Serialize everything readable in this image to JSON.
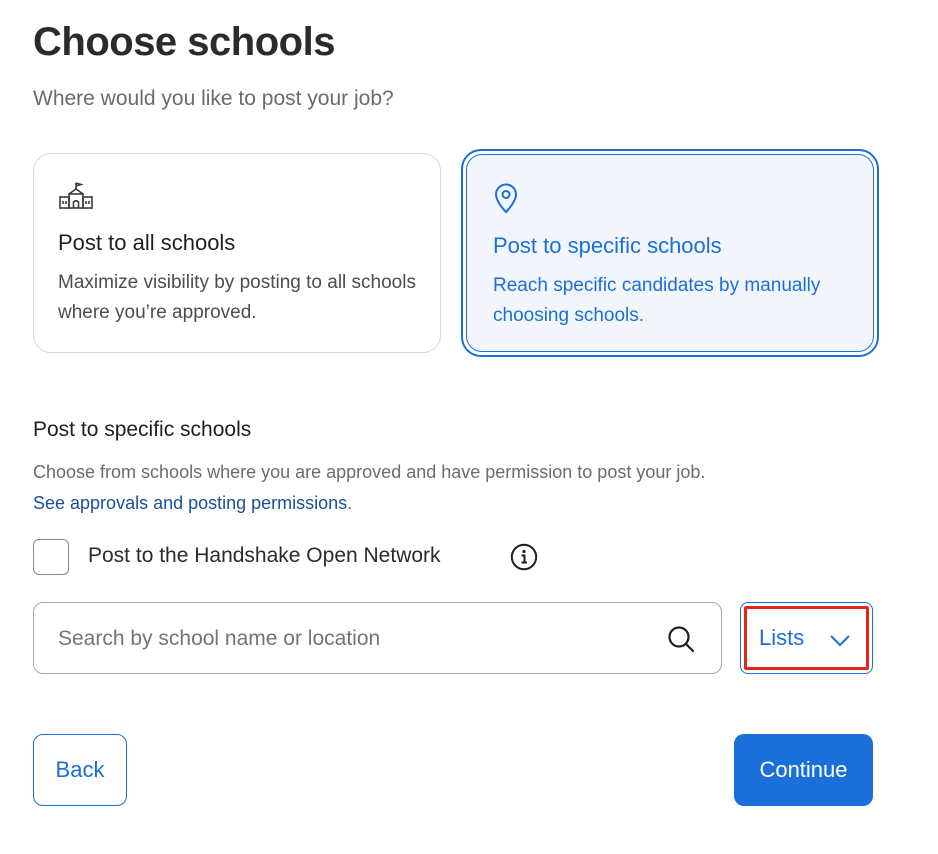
{
  "header": {
    "title": "Choose schools",
    "subtitle": "Where would you like to post your job?"
  },
  "options": [
    {
      "icon": "school-building-icon",
      "heading": "Post to all schools",
      "description": "Maximize visibility by posting to all schools where you’re approved.",
      "selected": false
    },
    {
      "icon": "location-pin-icon",
      "heading": "Post to specific schools",
      "description": "Reach specific candidates by manually choosing schools.",
      "selected": true
    }
  ],
  "specific_section": {
    "title": "Post to specific schools",
    "description": "Choose from schools where you are approved and have permission to post your job.",
    "link_text": "See approvals and posting permissions",
    "link_suffix": ".",
    "checkbox_label": "Post to the Handshake Open Network",
    "checkbox_checked": false,
    "search_placeholder": "Search by school name or location",
    "search_value": "",
    "lists_label": "Lists"
  },
  "footer": {
    "back_label": "Back",
    "continue_label": "Continue"
  },
  "colors": {
    "accent": "#1a6fd8",
    "selected_card_bg": "#f2f6fc",
    "link": "#1b4e9e",
    "highlight": "#e8231a"
  }
}
